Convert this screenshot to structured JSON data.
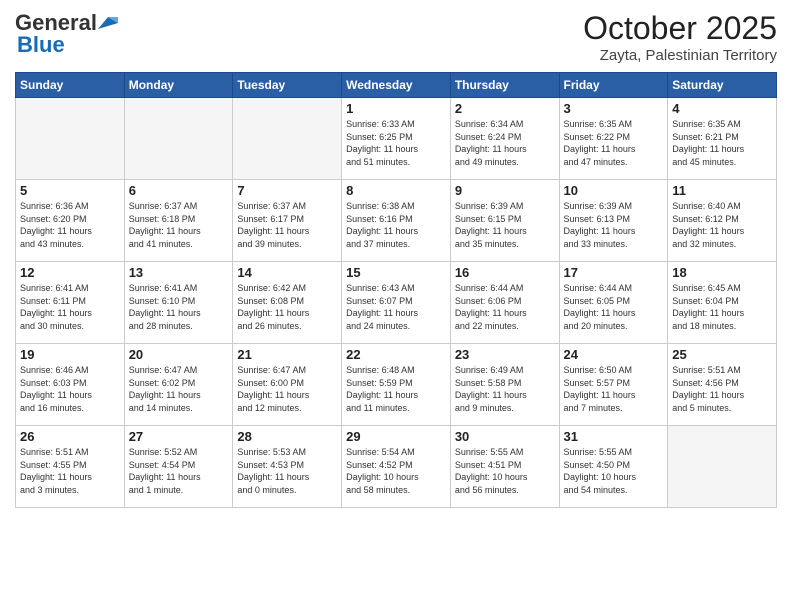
{
  "header": {
    "logo_general": "General",
    "logo_blue": "Blue",
    "month_title": "October 2025",
    "location": "Zayta, Palestinian Territory"
  },
  "weekdays": [
    "Sunday",
    "Monday",
    "Tuesday",
    "Wednesday",
    "Thursday",
    "Friday",
    "Saturday"
  ],
  "weeks": [
    [
      {
        "day": "",
        "info": ""
      },
      {
        "day": "",
        "info": ""
      },
      {
        "day": "",
        "info": ""
      },
      {
        "day": "1",
        "info": "Sunrise: 6:33 AM\nSunset: 6:25 PM\nDaylight: 11 hours\nand 51 minutes."
      },
      {
        "day": "2",
        "info": "Sunrise: 6:34 AM\nSunset: 6:24 PM\nDaylight: 11 hours\nand 49 minutes."
      },
      {
        "day": "3",
        "info": "Sunrise: 6:35 AM\nSunset: 6:22 PM\nDaylight: 11 hours\nand 47 minutes."
      },
      {
        "day": "4",
        "info": "Sunrise: 6:35 AM\nSunset: 6:21 PM\nDaylight: 11 hours\nand 45 minutes."
      }
    ],
    [
      {
        "day": "5",
        "info": "Sunrise: 6:36 AM\nSunset: 6:20 PM\nDaylight: 11 hours\nand 43 minutes."
      },
      {
        "day": "6",
        "info": "Sunrise: 6:37 AM\nSunset: 6:18 PM\nDaylight: 11 hours\nand 41 minutes."
      },
      {
        "day": "7",
        "info": "Sunrise: 6:37 AM\nSunset: 6:17 PM\nDaylight: 11 hours\nand 39 minutes."
      },
      {
        "day": "8",
        "info": "Sunrise: 6:38 AM\nSunset: 6:16 PM\nDaylight: 11 hours\nand 37 minutes."
      },
      {
        "day": "9",
        "info": "Sunrise: 6:39 AM\nSunset: 6:15 PM\nDaylight: 11 hours\nand 35 minutes."
      },
      {
        "day": "10",
        "info": "Sunrise: 6:39 AM\nSunset: 6:13 PM\nDaylight: 11 hours\nand 33 minutes."
      },
      {
        "day": "11",
        "info": "Sunrise: 6:40 AM\nSunset: 6:12 PM\nDaylight: 11 hours\nand 32 minutes."
      }
    ],
    [
      {
        "day": "12",
        "info": "Sunrise: 6:41 AM\nSunset: 6:11 PM\nDaylight: 11 hours\nand 30 minutes."
      },
      {
        "day": "13",
        "info": "Sunrise: 6:41 AM\nSunset: 6:10 PM\nDaylight: 11 hours\nand 28 minutes."
      },
      {
        "day": "14",
        "info": "Sunrise: 6:42 AM\nSunset: 6:08 PM\nDaylight: 11 hours\nand 26 minutes."
      },
      {
        "day": "15",
        "info": "Sunrise: 6:43 AM\nSunset: 6:07 PM\nDaylight: 11 hours\nand 24 minutes."
      },
      {
        "day": "16",
        "info": "Sunrise: 6:44 AM\nSunset: 6:06 PM\nDaylight: 11 hours\nand 22 minutes."
      },
      {
        "day": "17",
        "info": "Sunrise: 6:44 AM\nSunset: 6:05 PM\nDaylight: 11 hours\nand 20 minutes."
      },
      {
        "day": "18",
        "info": "Sunrise: 6:45 AM\nSunset: 6:04 PM\nDaylight: 11 hours\nand 18 minutes."
      }
    ],
    [
      {
        "day": "19",
        "info": "Sunrise: 6:46 AM\nSunset: 6:03 PM\nDaylight: 11 hours\nand 16 minutes."
      },
      {
        "day": "20",
        "info": "Sunrise: 6:47 AM\nSunset: 6:02 PM\nDaylight: 11 hours\nand 14 minutes."
      },
      {
        "day": "21",
        "info": "Sunrise: 6:47 AM\nSunset: 6:00 PM\nDaylight: 11 hours\nand 12 minutes."
      },
      {
        "day": "22",
        "info": "Sunrise: 6:48 AM\nSunset: 5:59 PM\nDaylight: 11 hours\nand 11 minutes."
      },
      {
        "day": "23",
        "info": "Sunrise: 6:49 AM\nSunset: 5:58 PM\nDaylight: 11 hours\nand 9 minutes."
      },
      {
        "day": "24",
        "info": "Sunrise: 6:50 AM\nSunset: 5:57 PM\nDaylight: 11 hours\nand 7 minutes."
      },
      {
        "day": "25",
        "info": "Sunrise: 5:51 AM\nSunset: 4:56 PM\nDaylight: 11 hours\nand 5 minutes."
      }
    ],
    [
      {
        "day": "26",
        "info": "Sunrise: 5:51 AM\nSunset: 4:55 PM\nDaylight: 11 hours\nand 3 minutes."
      },
      {
        "day": "27",
        "info": "Sunrise: 5:52 AM\nSunset: 4:54 PM\nDaylight: 11 hours\nand 1 minute."
      },
      {
        "day": "28",
        "info": "Sunrise: 5:53 AM\nSunset: 4:53 PM\nDaylight: 11 hours\nand 0 minutes."
      },
      {
        "day": "29",
        "info": "Sunrise: 5:54 AM\nSunset: 4:52 PM\nDaylight: 10 hours\nand 58 minutes."
      },
      {
        "day": "30",
        "info": "Sunrise: 5:55 AM\nSunset: 4:51 PM\nDaylight: 10 hours\nand 56 minutes."
      },
      {
        "day": "31",
        "info": "Sunrise: 5:55 AM\nSunset: 4:50 PM\nDaylight: 10 hours\nand 54 minutes."
      },
      {
        "day": "",
        "info": ""
      }
    ]
  ]
}
